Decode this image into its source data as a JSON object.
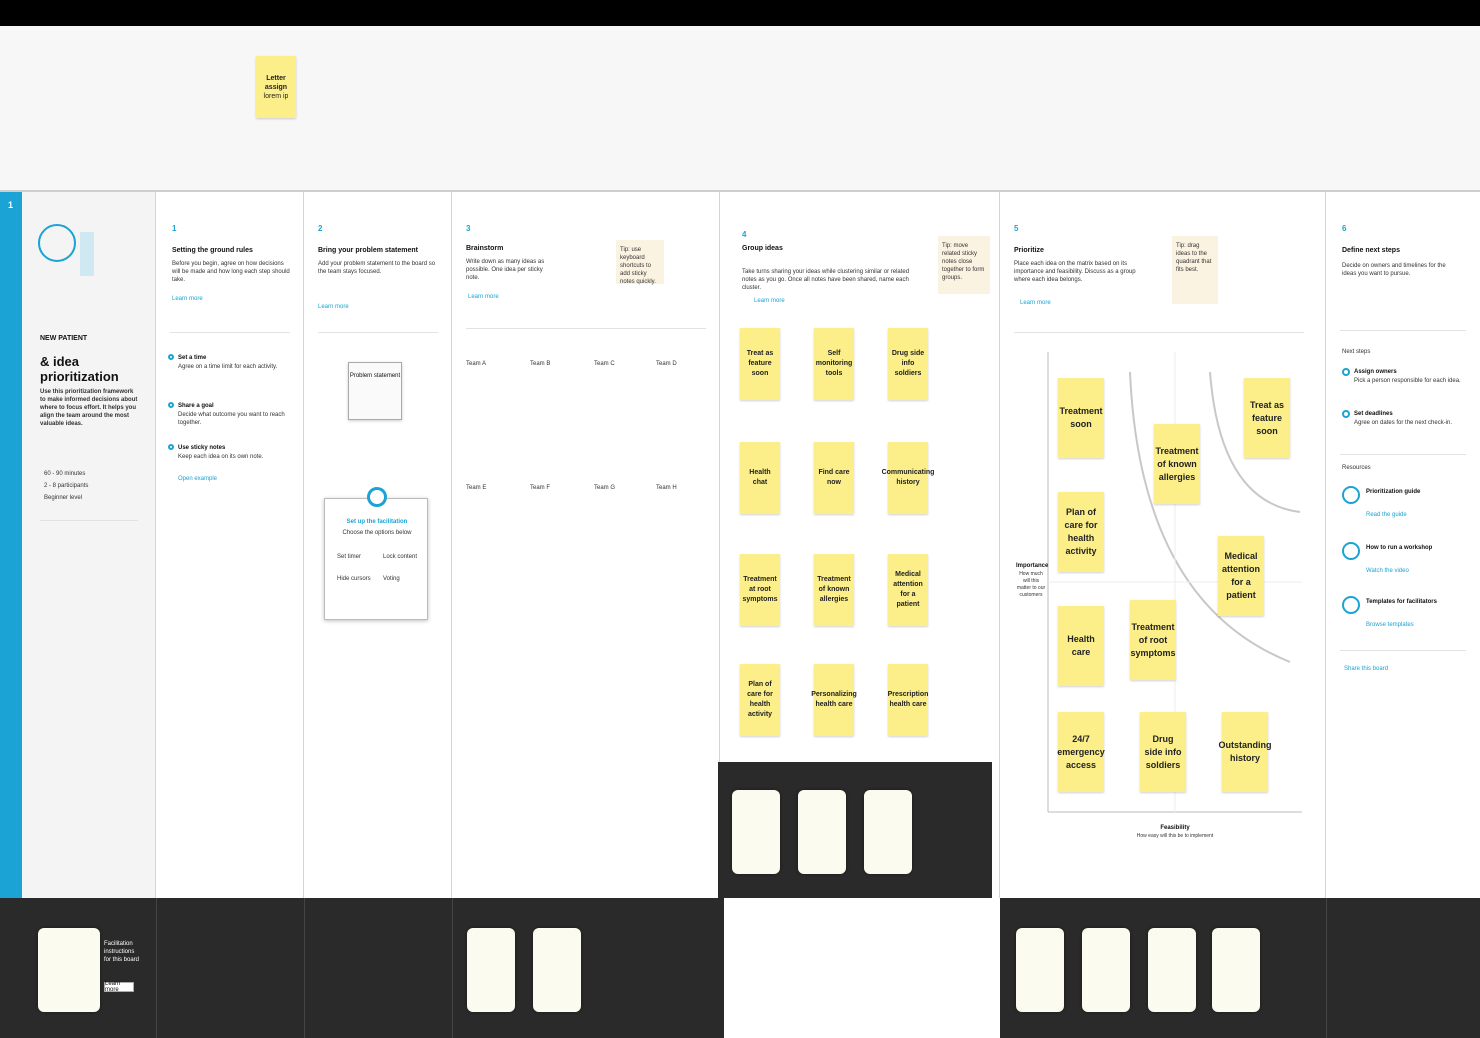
{
  "top_sticky": {
    "line1": "Letter assign",
    "line2": "lorem ip"
  },
  "sidebar": {
    "bar_label": "1"
  },
  "intro": {
    "eyebrow": "NEW PATIENT",
    "title": "& idea prioritization",
    "body": "Use this prioritization framework to make informed decisions about where to focus effort. It helps you align the team around the most valuable ideas.",
    "bullets": [
      "60 - 90 minutes",
      "2 - 8 participants",
      "Beginner level"
    ]
  },
  "step1": {
    "num": "1",
    "title": "Setting the ground rules",
    "body": "Before you begin, agree on how decisions will be made and how long each step should take.",
    "link": "Learn more",
    "items": [
      {
        "t": "Set a time",
        "d": "Agree on a time limit for each activity."
      },
      {
        "t": "Share a goal",
        "d": "Decide what outcome you want to reach together."
      },
      {
        "t": "Use sticky notes",
        "d": "Keep each idea on its own note."
      }
    ],
    "link2": "Open example"
  },
  "step2": {
    "num": "2",
    "title": "Bring your problem statement",
    "body": "Add your problem statement to the board so the team stays focused.",
    "link": "Learn more",
    "frame_label": "Problem statement",
    "dialog_title": "Set up the facilitation",
    "dialog_sub": "Choose the options below",
    "opts": [
      "Set timer",
      "Lock content",
      "Hide cursors",
      "Voting"
    ]
  },
  "step3": {
    "num": "3",
    "title": "Brainstorm",
    "body": "Write down as many ideas as possible. One idea per sticky note.",
    "link": "Learn more",
    "tip": "Tip: use keyboard shortcuts to add sticky notes quickly.",
    "groups": [
      "Team A",
      "Team B",
      "Team C",
      "Team D"
    ],
    "groups2": [
      "Team E",
      "Team F",
      "Team G",
      "Team H"
    ]
  },
  "step4": {
    "num": "4",
    "title": "Group ideas",
    "body": "Take turns sharing your ideas while clustering similar or related notes as you go. Once all notes have been shared, name each cluster.",
    "link": "Learn more",
    "tip": "Tip: move related sticky notes close together to form groups.",
    "notes": [
      "Treat as feature soon",
      "Self monitoring tools",
      "Drug side info soldiers",
      "Health chat",
      "Find care now",
      "Communicating history",
      "Treatment at root symptoms",
      "Treatment of known allergies",
      "Medical attention for a patient",
      "Plan of care for health activity",
      "Personalizing health care",
      "Prescription health care"
    ]
  },
  "step5": {
    "num": "5",
    "title": "Prioritize",
    "body": "Place each idea on the matrix based on its importance and feasibility. Discuss as a group where each idea belongs.",
    "link": "Learn more",
    "tip": "Tip: drag ideas to the quadrant that fits best.",
    "y_axis": "Importance",
    "y_sub": "How much will this matter to our customers",
    "x_axis": "Feasibility",
    "x_sub": "How easy will this be to implement",
    "notes": [
      "Treatment soon",
      "Treat as feature soon",
      "Treatment of known allergies",
      "Plan of care for health activity",
      "Medical attention for a patient",
      "Health care",
      "Treatment of root symptoms",
      "24/7 emergency access",
      "Drug side info soldiers",
      "Outstanding history"
    ]
  },
  "step6": {
    "num": "6",
    "title": "Define next steps",
    "body": "Decide on owners and timelines for the ideas you want to pursue.",
    "section1": "Next steps",
    "items1": [
      {
        "t": "Assign owners",
        "d": "Pick a person responsible for each idea."
      },
      {
        "t": "Set deadlines",
        "d": "Agree on dates for the next check-in."
      }
    ],
    "section2": "Resources",
    "items2": [
      {
        "t": "Prioritization guide",
        "l": "Read the guide"
      },
      {
        "t": "How to run a workshop",
        "l": "Watch the video"
      },
      {
        "t": "Templates for facilitators",
        "l": "Browse templates"
      }
    ],
    "link": "Share this board"
  },
  "footer": {
    "intro_caption": "Facilitation instructions for this board",
    "intro_btn": "Learn more"
  },
  "colors": {
    "accent": "#1aa3d4",
    "sticky": "#fcef8a",
    "dark": "#2a2a2a"
  }
}
